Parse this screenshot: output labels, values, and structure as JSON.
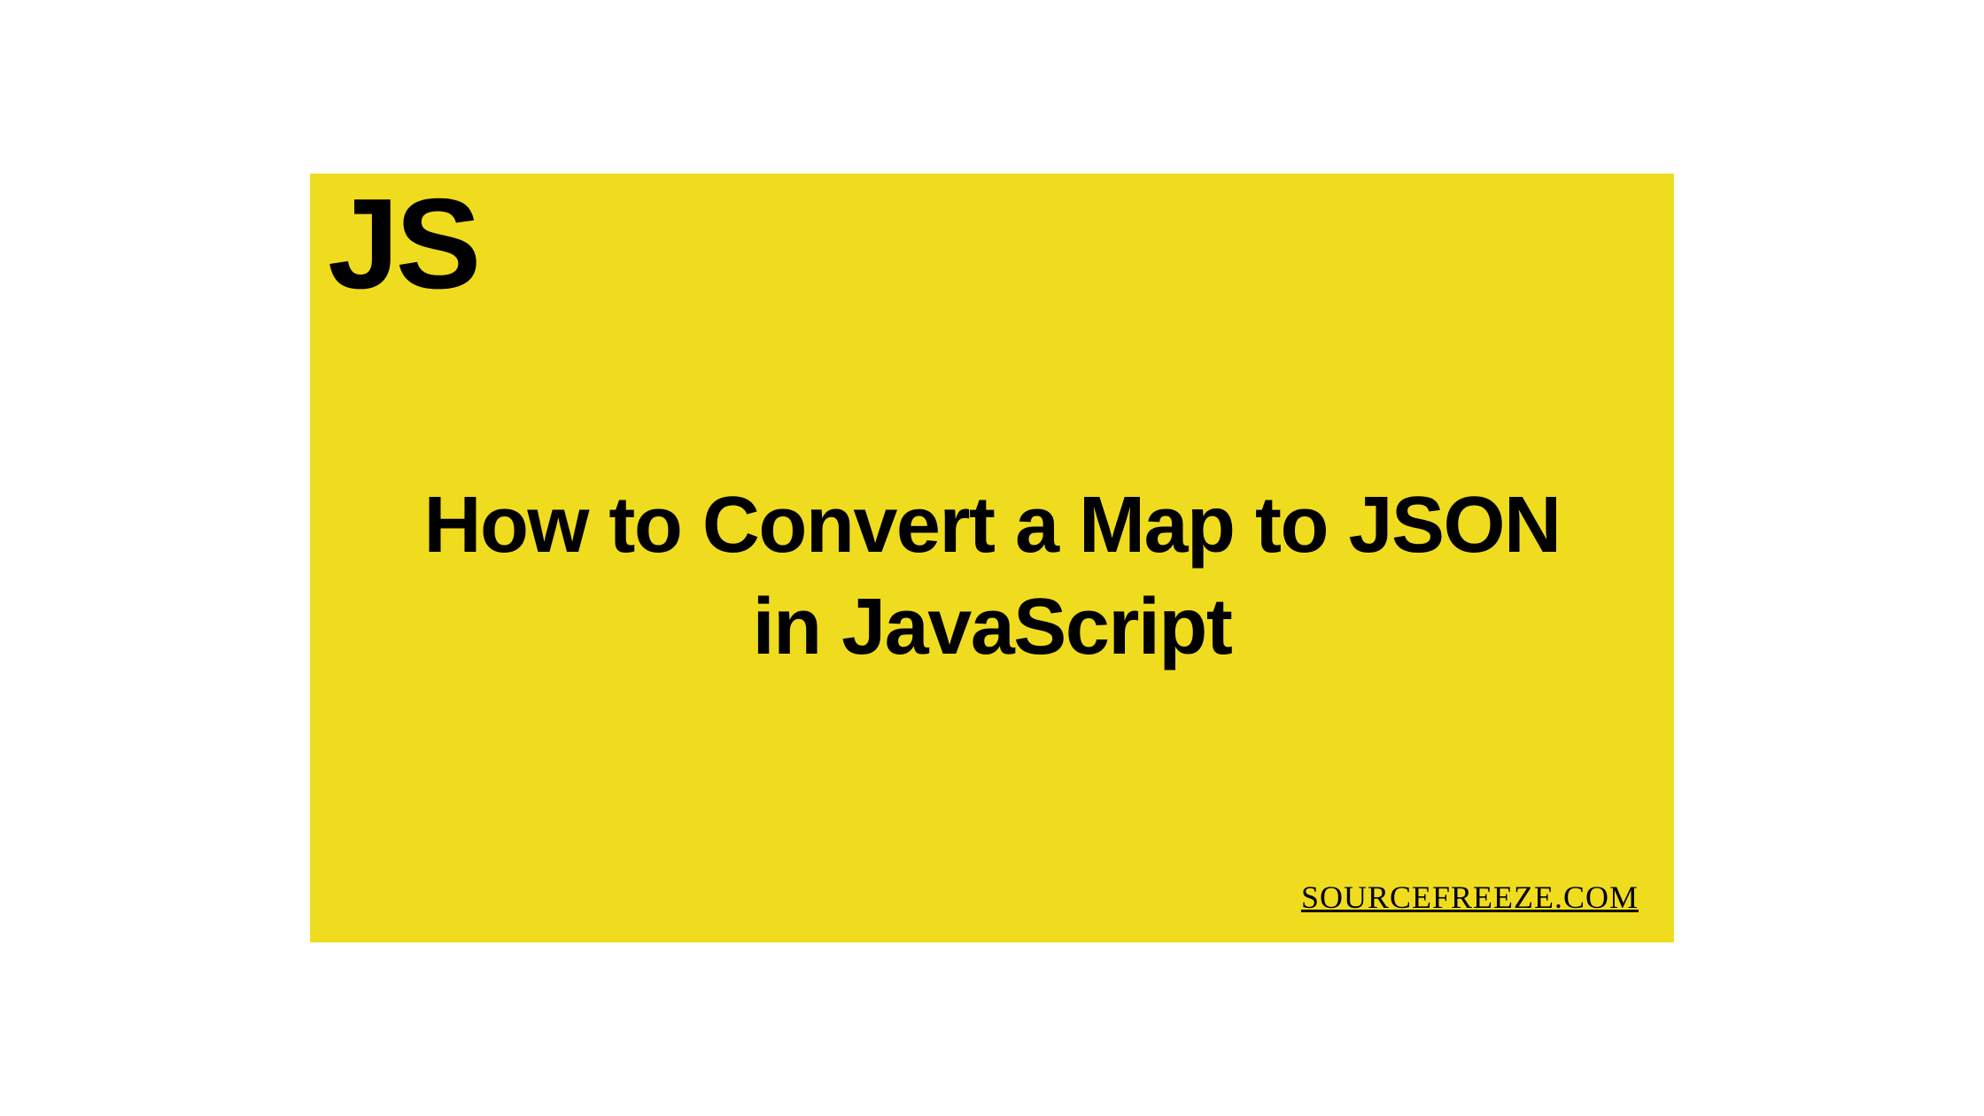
{
  "logo": {
    "text": "JS"
  },
  "title": "How to Convert a Map to JSON in JavaScript",
  "source": {
    "label": "SOURCEFREEZE.COM"
  },
  "colors": {
    "background": "#f0dc1e",
    "text": "#000000"
  }
}
